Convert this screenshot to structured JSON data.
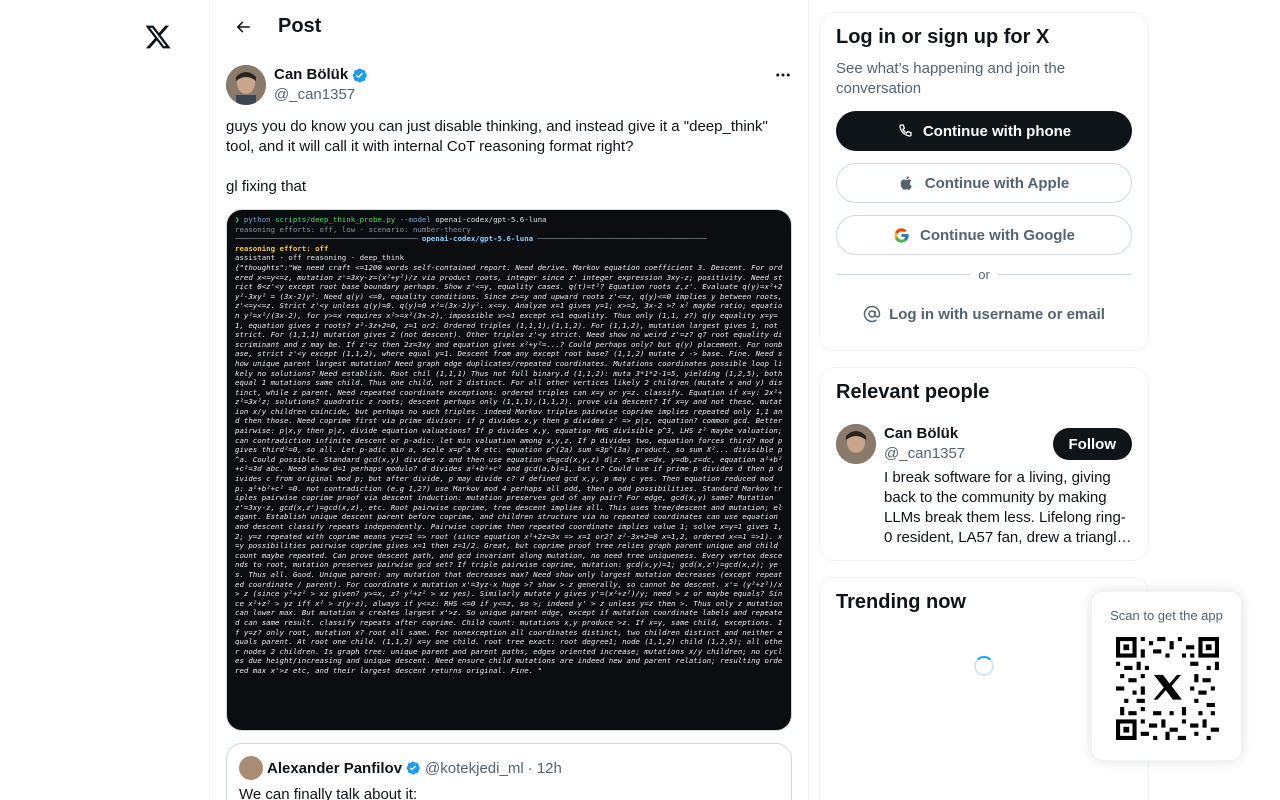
{
  "nav": {
    "logo_icon": "x-logo-icon"
  },
  "header": {
    "title": "Post",
    "back_icon": "arrow-left-icon"
  },
  "post": {
    "author_name": "Can Bölük",
    "author_handle": "@_can1357",
    "text": "guys you do know you can just disable thinking, and instead give it a \"deep_think\" tool, and it will call it with internal CoT reasoning format right?\n\ngl fixing that",
    "media": {
      "cmd_prompt": "❯",
      "cmd_python": "python",
      "cmd_script": "scripts/deep_think_probe.py",
      "cmd_flag": "--model",
      "cmd_model": "openai-codex/gpt-5.6-luna",
      "meta_line": "reasoning efforts: off, low · scenario: number-theory",
      "section_title": "openai-codex/gpt-5.6-luna",
      "effort_line": "reasoning effort: off",
      "mode_line": "assistant · off reasoning · deep_think",
      "body": "{\"thoughts\":\"We need craft <=1200 words self-contained report. Need derive. Markov equation coefficient 3. Descent. For ordered x<=y<=z, mutation z'=3xy-z=(x²+y²)/z via product roots, integer since z' integer expression 3xy-z; positivity. Need strict 0<z'<y except root base boundary perhaps. Show z'<=y, equality cases. q(t)=t²? Equation roots z,z'. Evaluate q(y)=x²+2y²-3xy² = (3x-2)y². Need q(y) <=0, equality conditions. Since z>=y and upward roots z'<=z, q(y)<=0 implies y between roots, z'<=y<=z. Strict z'<y unless q(y)=0. q(y)=0 x²=(3x-2)y². x<=y. Analyze x=1 gives y=1; x>=2, 3x-2 >? x² maybe ratio; equation y²=x²/(3x-2), for y>=x requires x²>=x²(3x-2), impossible x>=1 except x=1 equality. Thus only (1,1, z?) q(y equality x=y=1, equation gives z roots? z²-3z+2=0, z=1 or2. Ordered triples (1,1,1),(1,1,2). For (1,1,2), mutation largest gives 1, not strict. For (1,1,1) mutation gives 2 (not descent). Other triples z'<y strict. Need show no weird z'=z? q? root equality discriminant and z may be. If z'=z then 2z=3xy and equation gives x²+y²=...? Could perhaps only? but q(y) placement. For nonbase, strict z'<y except (1,1,2), where equal y=1. Descent from any except root base? (1,1,2) mutate z -> base. Fine. Need show unique parent largest mutation? Need graph edge duplicates/repeated coordinates. Mutations coordinates possible loop likely no solutions? Need establish. Root chil (1,1,1) Thus not full binary.d (1,1,2): muta 3*1*2-1=5, yielding (1,2,5), both equal 1 mutations same child. Thus one child, not 2 distinct. For all other vertices likely 2 children (mutate x and y) distinct, while z parent. Need repeated coordinate exceptions: ordered triples can x=y or y=z. classify. Equation if x=y: 2x²+z²=3x²z; solutions? quadratic z roots; descent perhaps only (1,1,1),(1,1,2). prove via descent? If x=y and not these, mutation x/y children coincide, but perhaps no such triples. indeed Markov triples pairwise coprime implies repeated only 1,1 and then those. Need coprime first via prime divisor: if p divides x,y then p divides z² => p|z, equation? common gcd. Better pairwise: p|x,y then p|z, divide equation valuations? If p divides x,y, equation RHS divisible p^3, LHS z² maybe valuation; can contradiction infinite descent or p-adic: let min valuation among x,y,z. If p divides two, equation forces third? mod p gives third²=0, so all. Let p-adic min a, scale x=p^a X etc: equation p^(2a) sum =3p^(3a) product, so sum X²... divisible p^a. Could possible. Standard gcd(x,y) divides z and then use equation d=gcd(x,y,z) d|z. Set x=dx, y=db,z=dc, equation a²+b²+c²=3d abc. Need show d=1 perhaps modulo? d divides a²+b²+c² and gcd(a,b)=1, but c? Could use if prime p divides d then p divides c from original mod p; but after divide, p may divide c? d defined gcd x,y, p may c yes. Then equation reduced mod p: a²+b²+c² =0. not contradiction (e.g 1,2?) use Markov mod 4 perhaps all odd, then p odd possibilities. Standard Markov triples pairwise coprime proof via descent induction: mutation preserves gcd of any pair? For edge, gcd(x,y) same? Mutation z'=3xy-z, gcd(x,z')=gcd(x,z), etc. Root pairwise coprime, tree descent implies all. This uses tree/descent and mutation; elegant. Establish unique descent parent before coprime, and children structure via no repeated coordinates can use equation and descent classify repeats independently. Pairwise coprime then repeated coordinate implies value 1; solve x=y=1 gives 1,2; y=z repeated with coprime means y=z=1 => root (since equation x²+2z=3x => x=1 or2? z²-3x+2=0 x=1,2, ordered x<=1 =>1). x=y possibilities pairwise coprime gives x=1 then z=1/2. Great, but coprime proof tree relies graph parent unique and child count maybe repeated. Can prove descent path, and gcd invariant along mutation, no need tree uniqueness. Every vertex descends to root, mutation preserves pairwise gcd set? If triple pairwise coprime, mutation: gcd(x,y)=1; gcd(x,z')=gcd(x,z); yes. Thus all. Good. Unique parent: any mutation that decreases max? Need show only largest mutation decreases (except repeated coordinate / parent). For coordinate x mutation x'=3yz-x huge >? show > z generally, so cannot be descent. x'= (y²+z²)/x > z (since y²+z² > xz given? y>=x, z? y²+z² > xz yes). Similarly mutate y gives y'=(x²+z²)/y; need > z or maybe equals? Since x²+z² > yz iff x² > z(y-z), always if y<=z: RHS <=0 if y<=z, so >; indeed y' > z unless y=z then >. Thus only z mutation can lower max. But mutation x creates largest x'>z. So unique parent edge, except if mutation coordinate labels and repeated can same result. classify repeats after coprime. Child count: mutations x,y produce >z. If x=y, same child, exceptions. If y=z? only root, mutation x? root all same. For nonexception all coordinates distinct, two children distinct and neither equals parent. At root one child. (1,1,2) x=y one child. root tree exact: root degree1; node (1,1,2) child (1,2,5); all other nodes 2 children. Is graph tree: unique parent and parent paths, edges oriented increase; mutations x/y children; no cycles due height/increasing and unique descent. Need ensure child mutations are indeed new and parent relation; resulting ordered max x'>z etc, and their largest descent returns original. Fine. \""
    },
    "quote": {
      "name": "Alexander Panfilov",
      "handle": "@kotekjedi_ml",
      "time": "· 12h",
      "text": "We can finally talk about it:"
    }
  },
  "login": {
    "title": "Log in or sign up for X",
    "subtitle": "See what’s happening and join the conversation",
    "phone_label": "Continue with phone",
    "apple_label": "Continue with Apple",
    "google_label": "Continue with Google",
    "or_label": "or",
    "username_label": "Log in with username or email"
  },
  "relevant": {
    "title": "Relevant people",
    "person": {
      "name": "Can Bölük",
      "handle": "@_can1357",
      "follow_label": "Follow",
      "bio": "I break software for a living, giving back to the community by making LLMs break them less. Lifelong ring-0 resident, LA57 fan, drew a triangl…"
    }
  },
  "trending": {
    "title": "Trending now"
  },
  "qr": {
    "label": "Scan to get the app"
  },
  "colors": {
    "accent": "#1d9bf0",
    "text": "#0f1419",
    "muted": "#536471",
    "border": "#cfd9de"
  }
}
